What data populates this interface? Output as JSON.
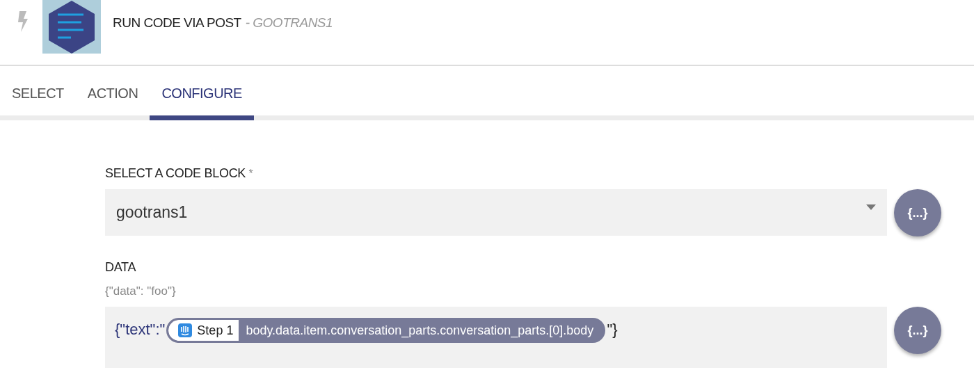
{
  "header": {
    "title": "RUN CODE VIA POST",
    "subtitle": "- GOOTRANS1"
  },
  "tabs": [
    {
      "label": "SELECT",
      "selected": false
    },
    {
      "label": "ACTION",
      "selected": false
    },
    {
      "label": "CONFIGURE",
      "selected": true
    }
  ],
  "fields": [
    {
      "kind": "select",
      "label": "SELECT A CODE BLOCK",
      "required_mark": "*",
      "value": "gootrans1",
      "button": "{...}"
    },
    {
      "kind": "code",
      "label": "DATA",
      "hint": "{\"data\": \"foo\"}",
      "prefix": "{\"text\":\"",
      "token": {
        "step": "Step 1",
        "path": "body.data.item.conversation_parts.conversation_parts.[0].body"
      },
      "suffix": "\"}",
      "button": "{...}"
    }
  ]
}
